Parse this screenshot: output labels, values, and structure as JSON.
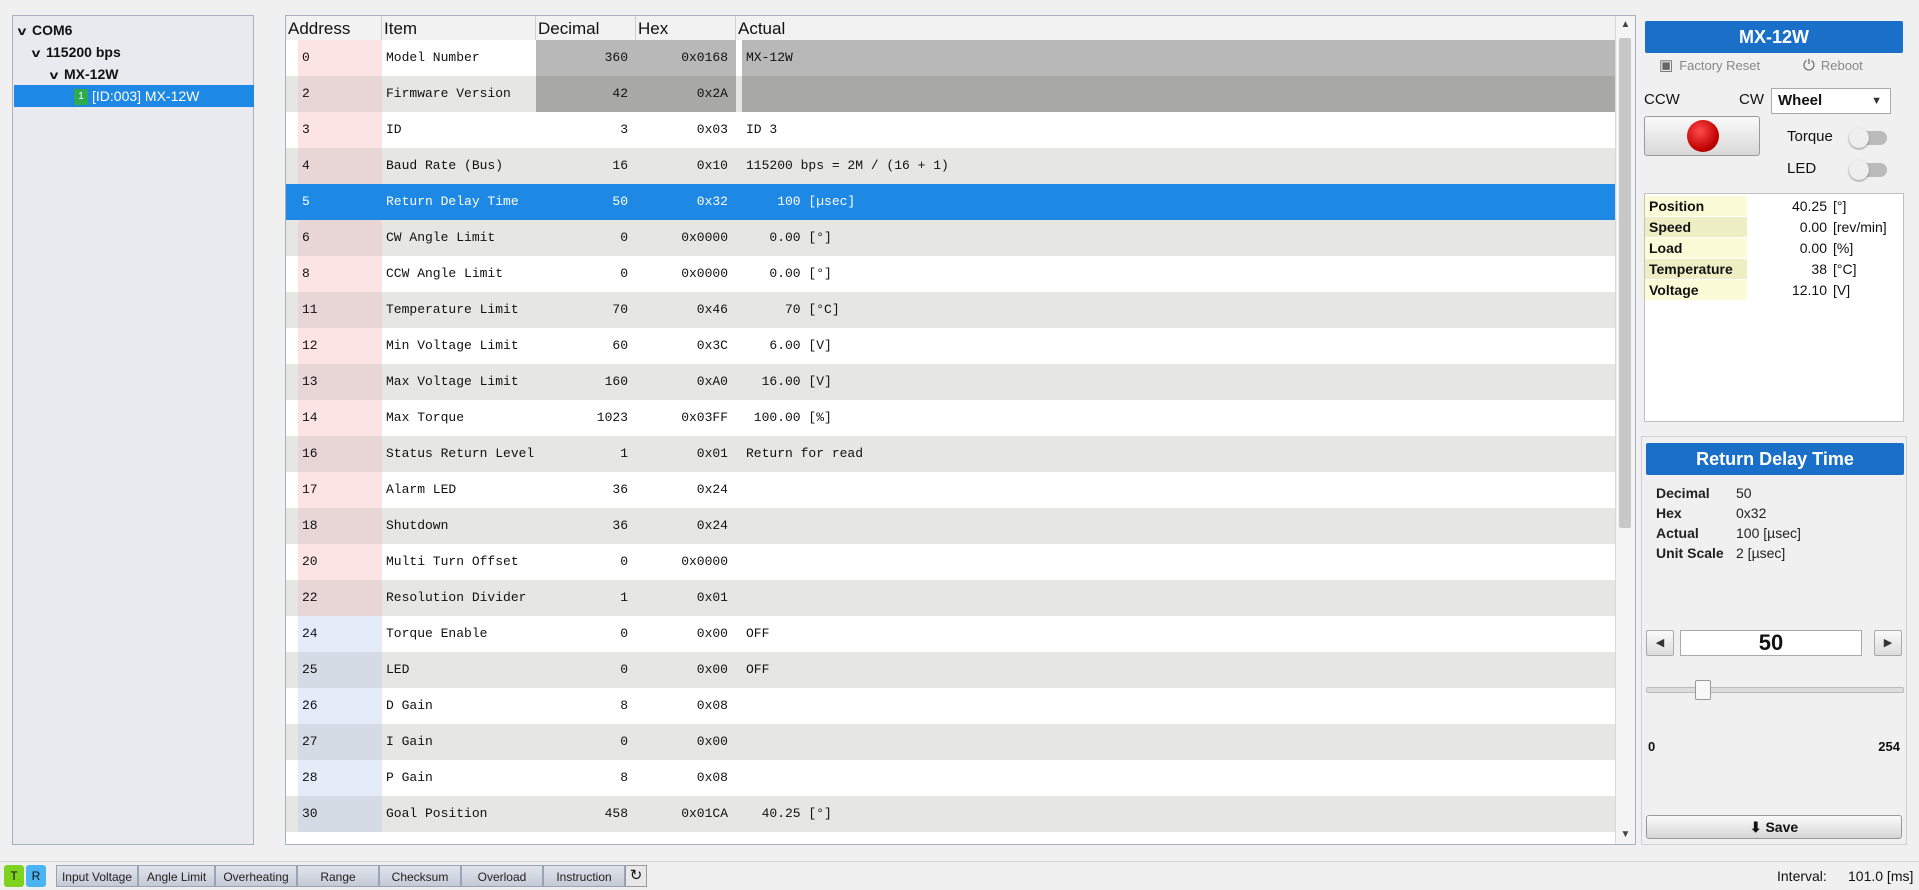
{
  "tree": {
    "port": "COM6",
    "baud": "115200 bps",
    "model": "MX-12W",
    "device_badge": "1",
    "device": "[ID:003] MX-12W"
  },
  "table": {
    "headers": [
      "Address",
      "Item",
      "Decimal",
      "Hex",
      "Actual"
    ],
    "rows": [
      {
        "address": "0",
        "item": "Model Number",
        "decimal": "360",
        "hex": "0x0168",
        "actual": "MX-12W"
      },
      {
        "address": "2",
        "item": "Firmware Version",
        "decimal": "42",
        "hex": "0x2A",
        "actual": ""
      },
      {
        "address": "3",
        "item": "ID",
        "decimal": "3",
        "hex": "0x03",
        "actual": "ID 3"
      },
      {
        "address": "4",
        "item": "Baud Rate (Bus)",
        "decimal": "16",
        "hex": "0x10",
        "actual": "115200 bps = 2M / (16 + 1)"
      },
      {
        "address": "5",
        "item": "Return Delay Time",
        "decimal": "50",
        "hex": "0x32",
        "actual": "    100 [µsec]"
      },
      {
        "address": "6",
        "item": "CW Angle Limit",
        "decimal": "0",
        "hex": "0x0000",
        "actual": "   0.00 [°]"
      },
      {
        "address": "8",
        "item": "CCW Angle Limit",
        "decimal": "0",
        "hex": "0x0000",
        "actual": "   0.00 [°]"
      },
      {
        "address": "11",
        "item": "Temperature Limit",
        "decimal": "70",
        "hex": "0x46",
        "actual": "     70 [°C]"
      },
      {
        "address": "12",
        "item": "Min Voltage Limit",
        "decimal": "60",
        "hex": "0x3C",
        "actual": "   6.00 [V]"
      },
      {
        "address": "13",
        "item": "Max Voltage Limit",
        "decimal": "160",
        "hex": "0xA0",
        "actual": "  16.00 [V]"
      },
      {
        "address": "14",
        "item": "Max Torque",
        "decimal": "1023",
        "hex": "0x03FF",
        "actual": " 100.00 [%]"
      },
      {
        "address": "16",
        "item": "Status Return Level",
        "decimal": "1",
        "hex": "0x01",
        "actual": "Return for read"
      },
      {
        "address": "17",
        "item": "Alarm LED",
        "decimal": "36",
        "hex": "0x24",
        "actual": ""
      },
      {
        "address": "18",
        "item": "Shutdown",
        "decimal": "36",
        "hex": "0x24",
        "actual": ""
      },
      {
        "address": "20",
        "item": "Multi Turn Offset",
        "decimal": "0",
        "hex": "0x0000",
        "actual": ""
      },
      {
        "address": "22",
        "item": "Resolution Divider",
        "decimal": "1",
        "hex": "0x01",
        "actual": ""
      },
      {
        "address": "24",
        "item": "Torque Enable",
        "decimal": "0",
        "hex": "0x00",
        "actual": "OFF"
      },
      {
        "address": "25",
        "item": "LED",
        "decimal": "0",
        "hex": "0x00",
        "actual": "OFF"
      },
      {
        "address": "26",
        "item": "D Gain",
        "decimal": "8",
        "hex": "0x08",
        "actual": ""
      },
      {
        "address": "27",
        "item": "I Gain",
        "decimal": "0",
        "hex": "0x00",
        "actual": ""
      },
      {
        "address": "28",
        "item": "P Gain",
        "decimal": "8",
        "hex": "0x08",
        "actual": ""
      },
      {
        "address": "30",
        "item": "Goal Position",
        "decimal": "458",
        "hex": "0x01CA",
        "actual": "  40.25 [°]"
      }
    ],
    "selected_address": "5"
  },
  "device_panel": {
    "title": "MX-12W",
    "factory_reset": "Factory Reset",
    "reboot": "Reboot",
    "ccw": "CCW",
    "cw": "CW",
    "mode": "Wheel",
    "torque_label": "Torque",
    "led_label": "LED",
    "torque_on": false,
    "led_on": false,
    "status": [
      {
        "key": "Position",
        "value": "40.25",
        "unit": "[°]"
      },
      {
        "key": "Speed",
        "value": "0.00",
        "unit": "[rev/min]"
      },
      {
        "key": "Load",
        "value": "0.00",
        "unit": "[%]"
      },
      {
        "key": "Temperature",
        "value": "38",
        "unit": "[°C]"
      },
      {
        "key": "Voltage",
        "value": "12.10",
        "unit": "[V]"
      }
    ]
  },
  "detail": {
    "title": "Return Delay Time",
    "fields": [
      {
        "key": "Decimal",
        "value": "50"
      },
      {
        "key": "Hex",
        "value": "0x32"
      },
      {
        "key": "Actual",
        "value": "100 [µsec]"
      },
      {
        "key": "Unit Scale",
        "value": "2 [µsec]"
      }
    ],
    "value": "50",
    "min": "0",
    "max": "254",
    "slider_fraction": 0.197,
    "save": "Save"
  },
  "bottom": {
    "t_label": "T",
    "r_label": "R",
    "t_color": "#7ed321",
    "r_color": "#4ab3f4",
    "errors": [
      "Input Voltage",
      "Angle Limit",
      "Overheating",
      "Range",
      "Checksum",
      "Overload",
      "Instruction"
    ],
    "interval_label": "Interval:",
    "interval_value": "101.0 [ms]"
  }
}
